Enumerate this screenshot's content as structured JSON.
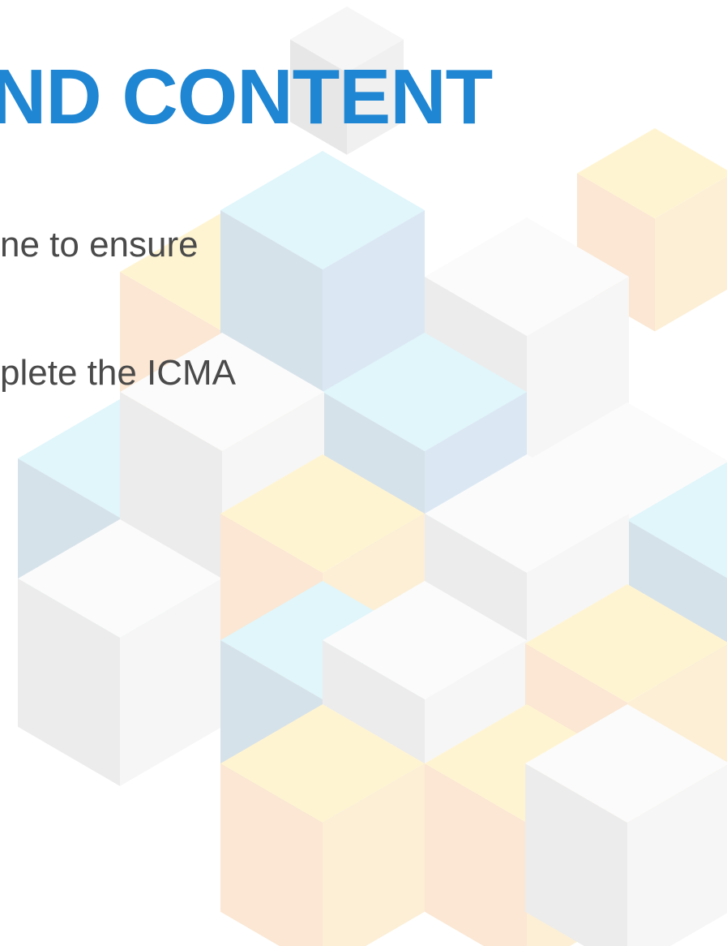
{
  "slide": {
    "heading": "ND CONTENT",
    "bullets": [
      "ne to ensure",
      "plete the ICMA"
    ]
  },
  "colors": {
    "accent": "#1f86d3",
    "text": "#4a4a4a",
    "cube_blue": "#cfe9f7",
    "cube_orange": "#f9e3cc",
    "cube_white": "#f1f1f1"
  }
}
